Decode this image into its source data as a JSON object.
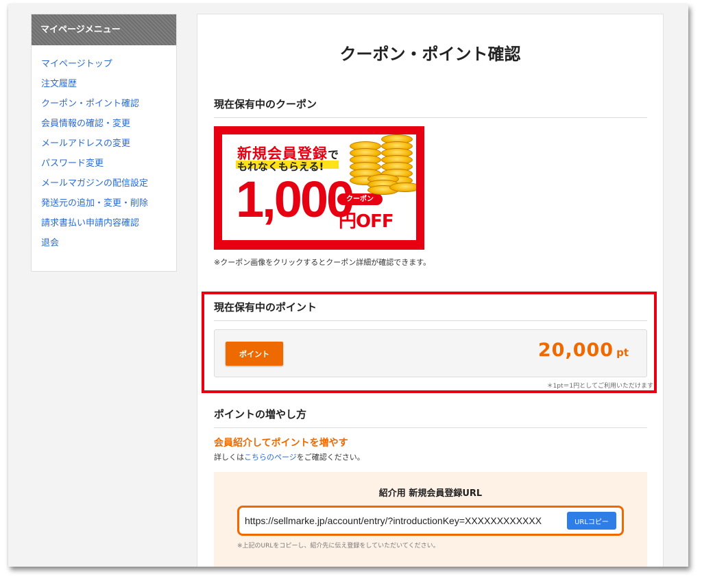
{
  "sidebar": {
    "title": "マイページメニュー",
    "items": [
      {
        "label": "マイページトップ"
      },
      {
        "label": "注文履歴"
      },
      {
        "label": "クーポン・ポイント確認"
      },
      {
        "label": "会員情報の確認・変更"
      },
      {
        "label": "メールアドレスの変更"
      },
      {
        "label": "パスワード変更"
      },
      {
        "label": "メールマガジンの配信設定"
      },
      {
        "label": "発送元の追加・変更・削除"
      },
      {
        "label": "請求書払い申請内容確認"
      },
      {
        "label": "退会"
      }
    ]
  },
  "main": {
    "title": "クーポン・ポイント確認",
    "coupons": {
      "heading": "現在保有中のクーポン",
      "banner": {
        "line1": "新規会員登録",
        "line1_suffix": "で",
        "line2": "もれなくもらえる!",
        "amount": "1,000",
        "badge": "クーポン",
        "off": "円OFF"
      },
      "note": "※クーポン画像をクリックするとクーポン詳細が確認できます。"
    },
    "points": {
      "heading": "現在保有中のポイント",
      "button_label": "ポイント",
      "value": "20,000",
      "unit": "pt",
      "note": "＊1pt＝1円としてご利用いただけます"
    },
    "earn": {
      "heading": "ポイントの増やし方",
      "referral_title": "会員紹介してポイントを増やす",
      "desc_before": "詳しくは",
      "desc_link": "こちらのページ",
      "desc_after": "をご確認ください。",
      "url_panel_title": "紹介用 新規会員登録URL",
      "url": "https://sellmarke.jp/account/entry/?introductionKey=XXXXXXXXXXXX",
      "copy_button": "URLコピー",
      "url_note": "※上記のURLをコピーし、紹介先に伝え登録をしていただいてください。"
    }
  },
  "colors": {
    "accent_orange": "#ee6a00",
    "highlight_red": "#e60012",
    "link_blue": "#2a6bd6",
    "copy_button_blue": "#2f7ee8"
  }
}
